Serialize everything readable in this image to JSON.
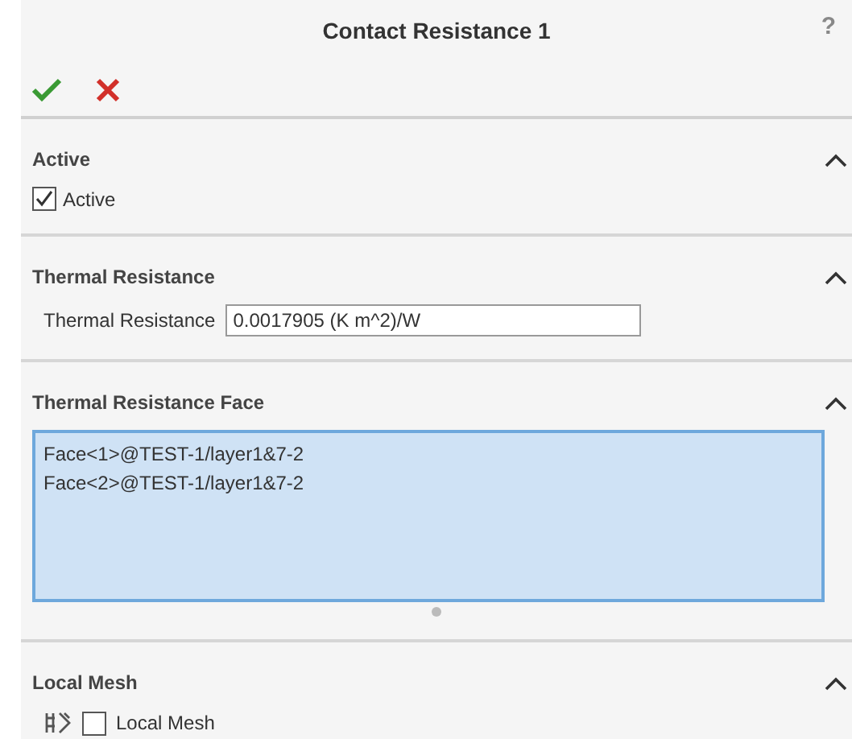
{
  "title": "Contact Resistance 1",
  "help": "?",
  "sections": [
    {
      "kind": "checkbox",
      "title": "Active",
      "expanded": true,
      "label": "Active",
      "checked": true
    },
    {
      "kind": "field",
      "title": "Thermal Resistance",
      "expanded": true,
      "label": "Thermal Resistance",
      "value": "0.0017905 (K m^2)/W"
    },
    {
      "kind": "list",
      "title": "Thermal Resistance Face",
      "expanded": true,
      "items": [
        "Face<1>@TEST-1/layer1&7-2",
        "Face<2>@TEST-1/layer1&7-2"
      ]
    },
    {
      "kind": "mesh",
      "title": "Local Mesh",
      "expanded": true,
      "label": "Local Mesh",
      "checked": false
    }
  ]
}
